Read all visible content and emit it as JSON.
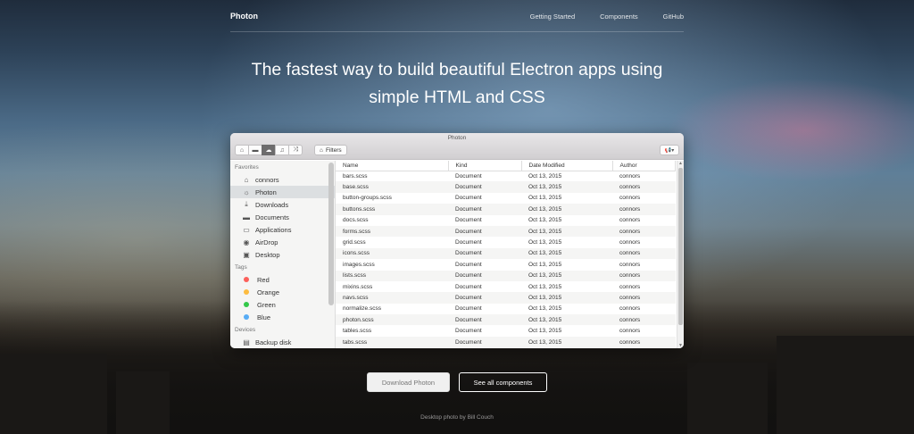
{
  "nav": {
    "brand": "Photon",
    "links": [
      "Getting Started",
      "Components",
      "GitHub"
    ]
  },
  "headline": {
    "line1": "The fastest way to build beautiful Electron apps using",
    "line2": "simple HTML and CSS"
  },
  "window": {
    "title": "Photon",
    "toolbar": {
      "icons": [
        "home-icon",
        "folder-icon",
        "cloud-icon",
        "popup-icon",
        "shuffle-icon"
      ],
      "active_index": 2,
      "filter_label": "Filters",
      "share_icon": "megaphone-icon"
    },
    "sidebar": {
      "groups": [
        {
          "label": "Favorites",
          "items": [
            {
              "label": "connors",
              "icon": "home-icon"
            },
            {
              "label": "Photon",
              "icon": "light-up-icon",
              "active": true
            },
            {
              "label": "Downloads",
              "icon": "download-icon"
            },
            {
              "label": "Documents",
              "icon": "folder-icon"
            },
            {
              "label": "Applications",
              "icon": "window-icon"
            },
            {
              "label": "AirDrop",
              "icon": "signal-icon"
            },
            {
              "label": "Desktop",
              "icon": "monitor-icon"
            }
          ]
        },
        {
          "label": "Tags",
          "items": [
            {
              "label": "Red",
              "color": "#fc605b"
            },
            {
              "label": "Orange",
              "color": "#fdbc40"
            },
            {
              "label": "Green",
              "color": "#34c84a"
            },
            {
              "label": "Blue",
              "color": "#57acf5"
            }
          ]
        },
        {
          "label": "Devices",
          "items": [
            {
              "label": "Backup disk",
              "icon": "drive-icon"
            }
          ]
        }
      ]
    },
    "table": {
      "columns": [
        "Name",
        "Kind",
        "Date Modified",
        "Author"
      ],
      "rows": [
        [
          "bars.scss",
          "Document",
          "Oct 13, 2015",
          "connors"
        ],
        [
          "base.scss",
          "Document",
          "Oct 13, 2015",
          "connors"
        ],
        [
          "button-groups.scss",
          "Document",
          "Oct 13, 2015",
          "connors"
        ],
        [
          "buttons.scss",
          "Document",
          "Oct 13, 2015",
          "connors"
        ],
        [
          "docs.scss",
          "Document",
          "Oct 13, 2015",
          "connors"
        ],
        [
          "forms.scss",
          "Document",
          "Oct 13, 2015",
          "connors"
        ],
        [
          "grid.scss",
          "Document",
          "Oct 13, 2015",
          "connors"
        ],
        [
          "icons.scss",
          "Document",
          "Oct 13, 2015",
          "connors"
        ],
        [
          "images.scss",
          "Document",
          "Oct 13, 2015",
          "connors"
        ],
        [
          "lists.scss",
          "Document",
          "Oct 13, 2015",
          "connors"
        ],
        [
          "mixins.scss",
          "Document",
          "Oct 13, 2015",
          "connors"
        ],
        [
          "navs.scss",
          "Document",
          "Oct 13, 2015",
          "connors"
        ],
        [
          "normalize.scss",
          "Document",
          "Oct 13, 2015",
          "connors"
        ],
        [
          "photon.scss",
          "Document",
          "Oct 13, 2015",
          "connors"
        ],
        [
          "tables.scss",
          "Document",
          "Oct 13, 2015",
          "connors"
        ],
        [
          "tabs.scss",
          "Document",
          "Oct 13, 2015",
          "connors"
        ]
      ]
    }
  },
  "cta": {
    "download_label": "Download Photon",
    "components_label": "See all components"
  },
  "credit": "Desktop photo by Bill Couch"
}
